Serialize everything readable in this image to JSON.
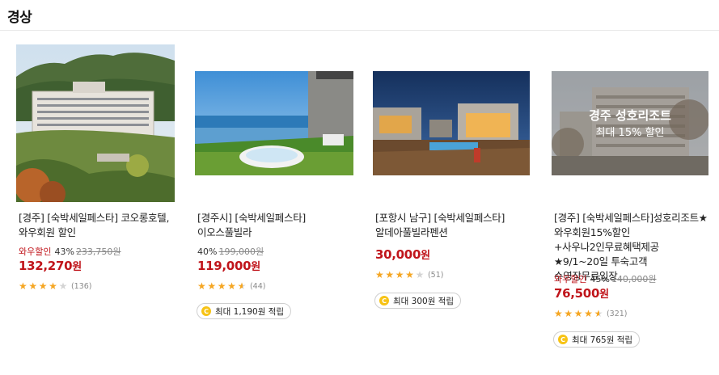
{
  "section": {
    "title": "경상"
  },
  "products": [
    {
      "name": "[경주] [숙박세일페스타] 코오롱호텔, 와우회원 할인",
      "discount_tag": "와우할인",
      "discount_percent": "43%",
      "original_price": "233,750원",
      "price": "132,270",
      "currency": "원",
      "rating": 4,
      "review_count": "(136)",
      "reward": "",
      "image": {
        "overlay_title": "",
        "overlay_sub": ""
      }
    },
    {
      "name": "[경주시] [숙박세일페스타]이오스풀빌라",
      "discount_tag": "",
      "discount_percent": "40%",
      "original_price": "199,000원",
      "price": "119,000",
      "currency": "원",
      "rating": 4.5,
      "review_count": "(44)",
      "reward": "최대 1,190원 적립",
      "image": {
        "overlay_title": "",
        "overlay_sub": ""
      }
    },
    {
      "name": "[포항시 남구] [숙박세일페스타]알데아풀빌라펜션",
      "discount_tag": "",
      "discount_percent": "",
      "original_price": "",
      "price": "30,000",
      "currency": "원",
      "rating": 4,
      "review_count": "(51)",
      "reward": "최대 300원 적립",
      "image": {
        "overlay_title": "",
        "overlay_sub": ""
      }
    },
    {
      "name": "[경주] [숙박세일페스타]성호리조트★와우회원15%할인+사우나2인무료혜택제공★9/1~20일 투숙고객 수영장무료입장",
      "discount_tag": "와우할인",
      "discount_percent": "45%",
      "original_price": "140,000원",
      "price": "76,500",
      "currency": "원",
      "rating": 4.5,
      "review_count": "(321)",
      "reward": "최대 765원 적립",
      "image": {
        "overlay_title": "경주 성호리조트",
        "overlay_sub": "최대 15% 할인"
      }
    }
  ],
  "colors": {
    "price": "#c0151b",
    "star": "#f5a623",
    "coin": "#f7c315"
  }
}
